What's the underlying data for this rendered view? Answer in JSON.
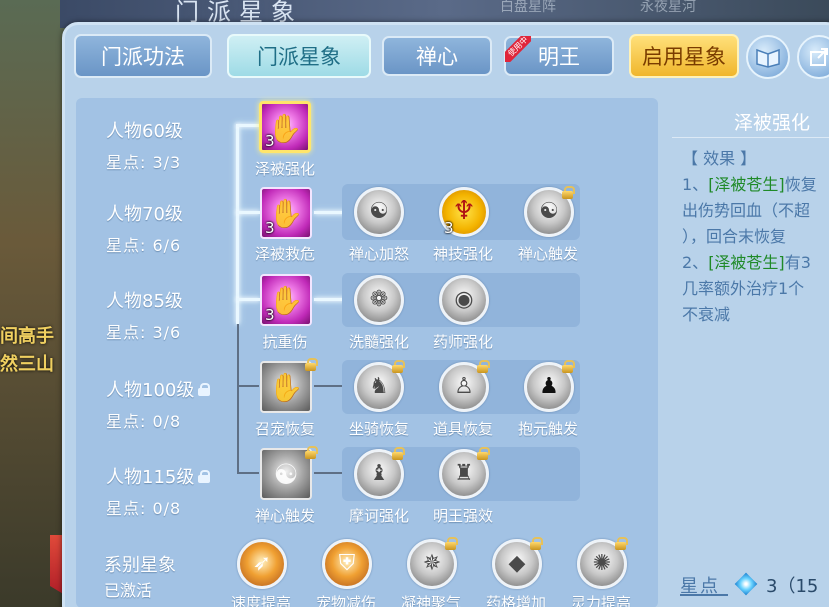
{
  "background": {
    "top_title": "门派星象",
    "top_right_1": "白盘星阵",
    "top_right_2": "永夜星河",
    "left_texts": [
      "间高手",
      "然三山"
    ]
  },
  "tabs": {
    "skills": "门派功法",
    "constellation": "门派星象",
    "zen_heart": "禅心",
    "ming_wang": "明王",
    "ming_wang_ribbon": "使用中",
    "enable": "启用星象"
  },
  "rows": [
    {
      "title": "人物60级",
      "sub": "星点: 3/3",
      "locked": false
    },
    {
      "title": "人物70级",
      "sub": "星点: 6/6",
      "locked": false
    },
    {
      "title": "人物85级",
      "sub": "星点: 3/6",
      "locked": false
    },
    {
      "title": "人物100级",
      "sub": "星点: 0/8",
      "locked": true
    },
    {
      "title": "人物115级",
      "sub": "星点: 0/8",
      "locked": true
    }
  ],
  "tree": {
    "r1": {
      "main": {
        "label": "泽被强化",
        "level": "3"
      }
    },
    "r2": {
      "main": {
        "label": "泽被救危",
        "level": "3"
      },
      "nodes": [
        {
          "label": "禅心加怒"
        },
        {
          "label": "神技强化",
          "level": "3"
        },
        {
          "label": "禅心触发"
        }
      ]
    },
    "r3": {
      "main": {
        "label": "抗重伤",
        "level": "3"
      },
      "nodes": [
        {
          "label": "洗髓强化"
        },
        {
          "label": "药师强化"
        }
      ]
    },
    "r4": {
      "main": {
        "label": "召宠恢复"
      },
      "nodes": [
        {
          "label": "坐骑恢复"
        },
        {
          "label": "道具恢复"
        },
        {
          "label": "抱元触发"
        }
      ]
    },
    "r5": {
      "main": {
        "label": "禅心触发"
      },
      "nodes": [
        {
          "label": "摩诃强化"
        },
        {
          "label": "明王强效"
        }
      ]
    }
  },
  "series": {
    "title": "系别星象",
    "status": "已激活",
    "items": [
      {
        "label": "速度提高"
      },
      {
        "label": "宠物减伤"
      },
      {
        "label": "凝神聚气"
      },
      {
        "label": "药格增加"
      },
      {
        "label": "灵力提高"
      }
    ]
  },
  "detail": {
    "title": "泽被强化",
    "effect_header": "【 效果 】",
    "line1_prefix": "1、",
    "line1_tag": "[泽被苍生]",
    "line1_rest": "恢复",
    "line2": "出伤势回血（不超",
    "line3": "），回合末恢复",
    "line4_prefix": "2、",
    "line4_tag": "[泽被苍生]",
    "line4_rest": "有3",
    "line5": "几率额外治疗1个",
    "line6": "不衰减"
  },
  "star_points": {
    "label": "星点",
    "value": "3（15"
  }
}
